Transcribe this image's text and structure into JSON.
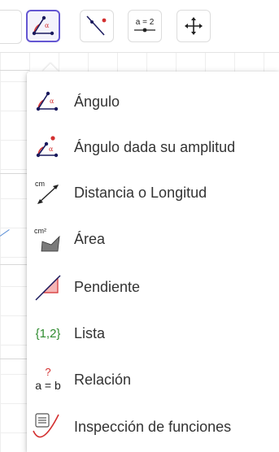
{
  "toolbar": {
    "buttons": [
      {
        "icon": "angle-icon",
        "active": true
      },
      {
        "icon": "line-point-icon",
        "active": false
      },
      {
        "icon": "slider-icon",
        "label": "a = 2",
        "active": false
      },
      {
        "icon": "move-graphics-icon",
        "active": false
      }
    ]
  },
  "submenu": {
    "items": [
      {
        "label": "Ángulo",
        "icon": "angle-icon"
      },
      {
        "label": "Ángulo dada su amplitud",
        "icon": "angle-fixed-size-icon"
      },
      {
        "label": "Distancia o Longitud",
        "icon": "distance-icon",
        "icon_text": "cm"
      },
      {
        "label": "Área",
        "icon": "area-icon",
        "icon_text": "cm²"
      },
      {
        "label": "Pendiente",
        "icon": "slope-icon"
      },
      {
        "label": "Lista",
        "icon": "list-icon",
        "icon_text": "{1,2}"
      },
      {
        "label": "Relación",
        "icon": "relation-icon",
        "icon_text_top": "?",
        "icon_text": "a = b"
      },
      {
        "label": "Inspección de funciones",
        "icon": "function-inspector-icon"
      }
    ]
  },
  "icon_labels": {
    "alpha": "α",
    "slider": "a = 2"
  },
  "colors": {
    "accent": "#6557d2",
    "angle_red": "#d32f2f",
    "angle_fill": "#f5b5b5",
    "dark_blue": "#1a1a5e",
    "list_green": "#2e8b2e"
  }
}
